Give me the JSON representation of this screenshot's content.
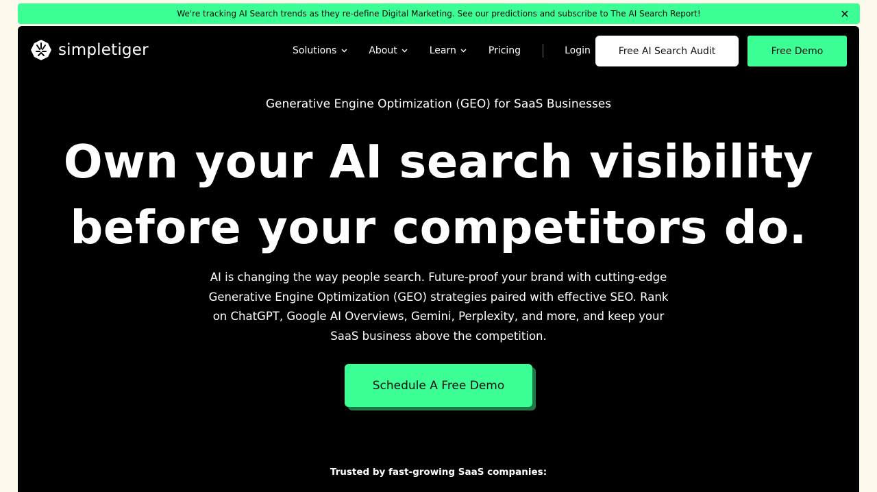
{
  "colors": {
    "accent": "#3cff95",
    "page_background": "#fdf9ec",
    "hero_background": "#000000",
    "text_on_dark": "#ffffff"
  },
  "announcement": {
    "text": "We're tracking AI Search trends as they re-define Digital Marketing. See our predictions and subscribe to The AI Search Report!",
    "close_icon": "close-icon",
    "close_glyph": "✕"
  },
  "header": {
    "logo_icon": "tiger-logo-icon",
    "logo_text": "simpletiger",
    "nav": [
      {
        "label": "Solutions",
        "dropdown": true
      },
      {
        "label": "About",
        "dropdown": true
      },
      {
        "label": "Learn",
        "dropdown": true
      },
      {
        "label": "Pricing",
        "dropdown": false
      }
    ],
    "login_label": "Login",
    "audit_button": "Free AI Search Audit",
    "demo_button": "Free Demo"
  },
  "hero": {
    "eyebrow": "Generative Engine Optimization (GEO) for SaaS Businesses",
    "headline_line1": "Own your AI search visibility",
    "headline_line2": "before your competitors do.",
    "subtext": "AI is changing the way people search. Future-proof your brand with cutting-edge Generative Engine Optimization (GEO) strategies paired with effective SEO. Rank on ChatGPT, Google AI Overviews, Gemini, Perplexity, and more, and keep your SaaS business above the competition.",
    "cta": "Schedule A Free Demo",
    "trusted": "Trusted by fast-growing SaaS companies:"
  }
}
